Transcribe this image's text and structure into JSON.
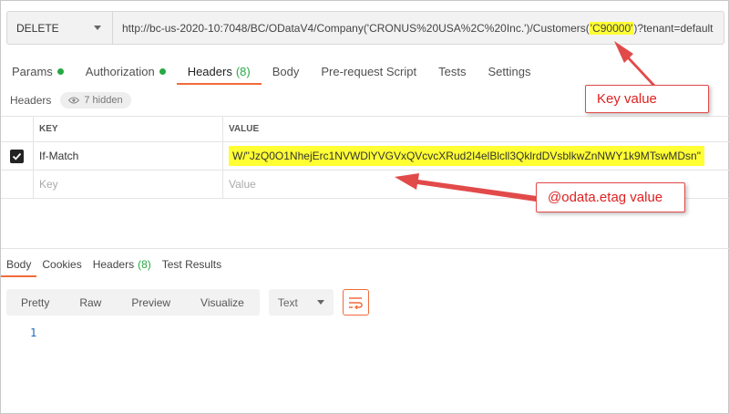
{
  "request": {
    "method": "DELETE",
    "url_prefix": "http://bc-us-2020-10:7048/BC/ODataV4/Company('CRONUS%20USA%2C%20Inc.')/Customers(",
    "url_key": "'C90000'",
    "url_suffix": ")?tenant=default"
  },
  "tabs": [
    {
      "label": "Params",
      "dot": true
    },
    {
      "label": "Authorization",
      "dot": true
    },
    {
      "label": "Headers",
      "count": "(8)"
    },
    {
      "label": "Body"
    },
    {
      "label": "Pre-request Script"
    },
    {
      "label": "Tests"
    },
    {
      "label": "Settings"
    }
  ],
  "headers_section": {
    "title": "Headers",
    "hidden_label": "7 hidden"
  },
  "table": {
    "col_key": "KEY",
    "col_value": "VALUE",
    "rows": [
      {
        "key": "If-Match",
        "value": "W/\"JzQ0O1NhejErc1NVWDlYVGVxQVcvcXRud2I4elBlcll3QklrdDVsblkwZnNWY1k9MTswMDsn\""
      }
    ],
    "placeholder_key": "Key",
    "placeholder_value": "Value"
  },
  "response_tabs": [
    {
      "label": "Body"
    },
    {
      "label": "Cookies"
    },
    {
      "label": "Headers",
      "count": "(8)"
    },
    {
      "label": "Test Results"
    }
  ],
  "view_options": [
    "Pretty",
    "Raw",
    "Preview",
    "Visualize"
  ],
  "format_select": "Text",
  "line_number": "1",
  "annotations": {
    "key_value": "Key value",
    "etag_value": "@odata.etag value"
  },
  "colors": {
    "accent": "#f26b3a",
    "highlight": "#ffff33",
    "annotation": "#e02020",
    "status_dot": "#27a844"
  }
}
